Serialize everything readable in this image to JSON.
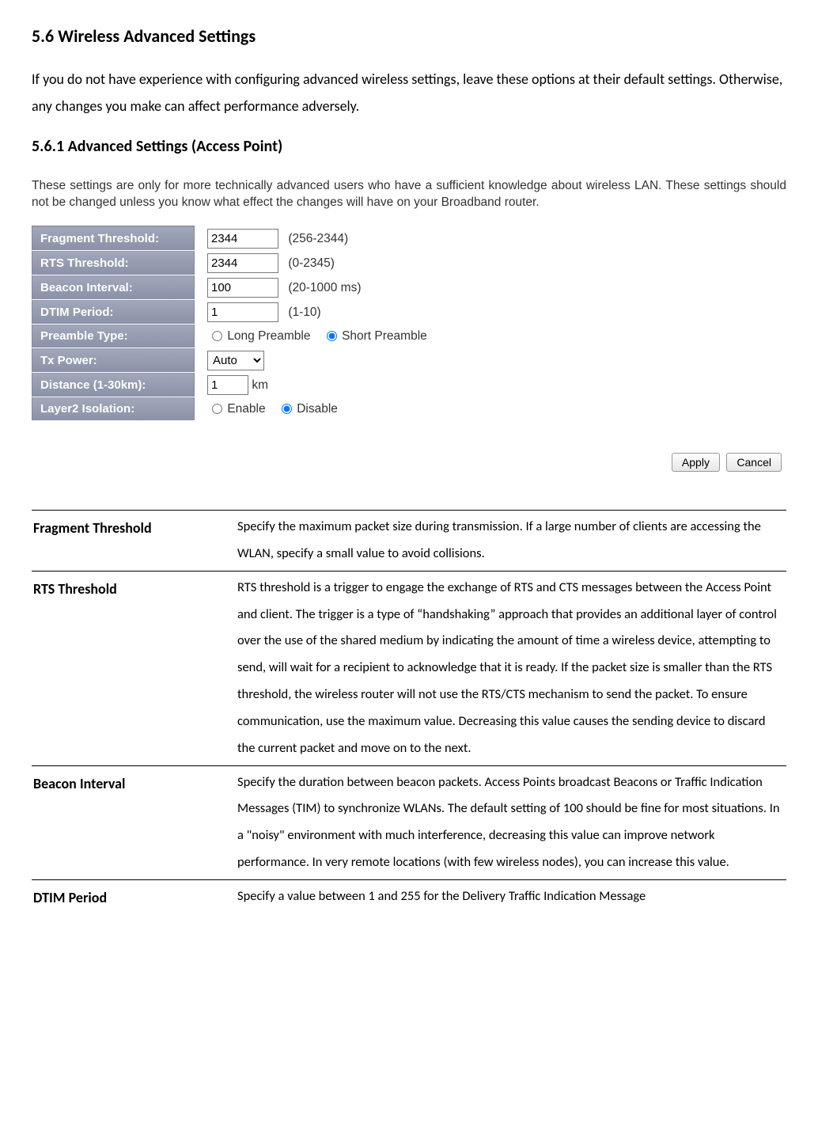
{
  "section": {
    "title": "5.6 Wireless Advanced Settings",
    "intro": "If you do not have experience with configuring advanced wireless settings, leave these options at their default settings. Otherwise, any changes you make can affect performance adversely.",
    "subsection_title": "5.6.1 Advanced Settings (Access Point)"
  },
  "screenshot": {
    "hint": "These settings are only for more technically advanced users who have a sufficient knowledge about wireless LAN. These settings should not be changed unless you know what effect the changes will have on your Broadband router.",
    "rows": {
      "fragment": {
        "label": "Fragment Threshold:",
        "value": "2344",
        "range": "(256-2344)"
      },
      "rts": {
        "label": "RTS Threshold:",
        "value": "2344",
        "range": "(0-2345)"
      },
      "beacon": {
        "label": "Beacon Interval:",
        "value": "100",
        "range": "(20-1000 ms)"
      },
      "dtim": {
        "label": "DTIM Period:",
        "value": "1",
        "range": "(1-10)"
      },
      "preamble": {
        "label": "Preamble Type:",
        "opt1": "Long Preamble",
        "opt2": "Short Preamble"
      },
      "txpower": {
        "label": "Tx Power:",
        "value": "Auto"
      },
      "distance": {
        "label": "Distance (1-30km):",
        "value": "1",
        "unit": "km"
      },
      "layer2": {
        "label": "Layer2 Isolation:",
        "opt1": "Enable",
        "opt2": "Disable"
      }
    },
    "buttons": {
      "apply": "Apply",
      "cancel": "Cancel"
    }
  },
  "definitions": [
    {
      "term": "Fragment Threshold",
      "desc": "Specify the maximum packet size during transmission. If a large number of clients are accessing the WLAN, specify a small value to avoid collisions."
    },
    {
      "term": "RTS Threshold",
      "desc": "RTS threshold is a trigger to engage the exchange of RTS and CTS messages between the Access Point and client. The trigger is a type of “handshaking” approach that provides an additional layer of control over the use of the shared medium by indicating the amount of time a wireless device, attempting to send, will wait for a recipient to acknowledge that it is ready. If the packet size is smaller than the RTS threshold, the wireless router will not use the RTS/CTS mechanism to send the packet. To ensure communication, use the maximum value. Decreasing this value causes the sending device to discard the current packet and move on to the next."
    },
    {
      "term": "Beacon Interval",
      "desc": "Specify the duration between beacon packets. Access Points broadcast Beacons or Traffic Indication Messages (TIM) to synchronize WLANs. The default setting of 100 should be fine for most situations. In a \"noisy\" environment with much interference, decreasing this value can improve network performance. In very remote locations (with few wireless nodes), you can increase this value."
    },
    {
      "term": "DTIM Period",
      "desc": "Specify a value between 1 and 255 for the Delivery Traffic Indication Message"
    }
  ]
}
